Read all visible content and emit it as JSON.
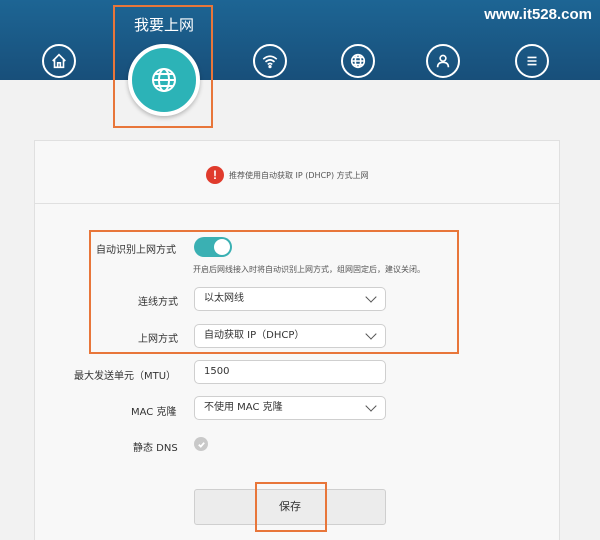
{
  "header": {
    "watermark": "www.it528.com",
    "active_title": "我要上网",
    "nav_icons": [
      "home-icon",
      "globe-icon",
      "wifi-icon",
      "globe-settings-icon",
      "user-icon",
      "menu-icon"
    ]
  },
  "notice": {
    "text": "推荐使用自动获取 IP (DHCP) 方式上网",
    "icon": "!"
  },
  "form": {
    "auto_detect_label": "自动识别上网方式",
    "auto_detect_hint": "开启后网线接入时将自动识别上网方式，组网固定后，建议关闭。",
    "auto_detect_on": true,
    "connection_label": "连线方式",
    "connection_value": "以太网线",
    "wan_mode_label": "上网方式",
    "wan_mode_value": "自动获取 IP（DHCP）",
    "mtu_label": "最大发送单元（MTU）",
    "mtu_value": "1500",
    "mac_label": "MAC 克隆",
    "mac_value": "不使用 MAC 克隆",
    "static_dns_label": "静态 DNS",
    "static_dns_checked": false
  },
  "actions": {
    "save_label": "保存"
  },
  "colors": {
    "header": "#1b5f8e",
    "accent": "#2cb3b7",
    "highlight": "#e8763a",
    "warning": "#e03b2d"
  }
}
